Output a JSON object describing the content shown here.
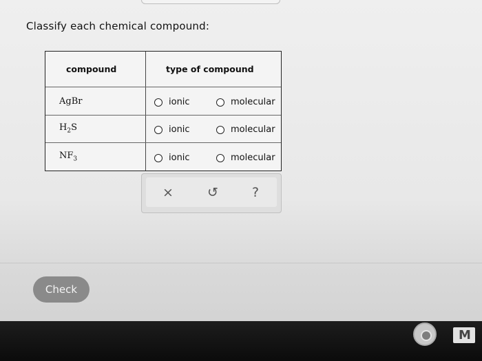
{
  "prompt": "Classify each chemical compound:",
  "table": {
    "headers": [
      "compound",
      "type of compound"
    ],
    "rows": [
      {
        "compound_main": "AgBr",
        "compound_sub": "",
        "compound_tail": "",
        "option1": "ionic",
        "option2": "molecular"
      },
      {
        "compound_main": "H",
        "compound_sub": "2",
        "compound_tail": "S",
        "option1": "ionic",
        "option2": "molecular"
      },
      {
        "compound_main": "NF",
        "compound_sub": "3",
        "compound_tail": "",
        "option1": "ionic",
        "option2": "molecular"
      }
    ]
  },
  "toolbar": {
    "clear_symbol": "×",
    "undo_symbol": "↺",
    "help_symbol": "?"
  },
  "check_label": "Check",
  "icons": {
    "tray_1": "chrome-icon",
    "tray_2": "gmail-icon"
  }
}
